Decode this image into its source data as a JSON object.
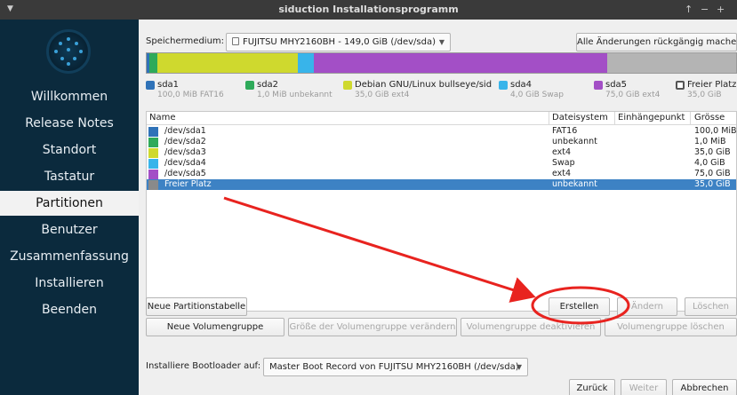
{
  "window": {
    "title": "siduction Installationsprogramm",
    "controls": [
      "↑",
      "−",
      "+"
    ]
  },
  "sidebar": {
    "items": [
      {
        "label": "Willkommen",
        "active": false
      },
      {
        "label": "Release Notes",
        "active": false
      },
      {
        "label": "Standort",
        "active": false
      },
      {
        "label": "Tastatur",
        "active": false
      },
      {
        "label": "Partitionen",
        "active": true
      },
      {
        "label": "Benutzer",
        "active": false
      },
      {
        "label": "Zusammenfassung",
        "active": false
      },
      {
        "label": "Installieren",
        "active": false
      },
      {
        "label": "Beenden",
        "active": false
      }
    ]
  },
  "storage": {
    "label": "Speichermedium:",
    "device": "FUJITSU MHY2160BH - 149,0 GiB (/dev/sda)",
    "revert_button": "Alle Änderungen rückgängig machen"
  },
  "partition_bar": {
    "colors": {
      "sda1": "#2f72b8",
      "sda2": "#2eaa5a",
      "sda3": "#cfd92e",
      "sda4": "#38b4ea",
      "sda5": "#a34fc6",
      "free": "#b4b4b4"
    }
  },
  "legend": [
    {
      "name": "sda1",
      "sub": "100,0 MiB FAT16",
      "color": "#2f72b8"
    },
    {
      "name": "sda2",
      "sub": "1,0 MiB unbekannt",
      "color": "#2eaa5a"
    },
    {
      "name": "Debian GNU/Linux bullseye/sid",
      "sub": "35,0 GiB ext4",
      "color": "#cfd92e"
    },
    {
      "name": "sda4",
      "sub": "4,0 GiB Swap",
      "color": "#38b4ea"
    },
    {
      "name": "sda5",
      "sub": "75,0 GiB ext4",
      "color": "#a34fc6"
    },
    {
      "name": "Freier Platz",
      "sub": "35,0 GiB",
      "color": "#ffffff"
    }
  ],
  "table": {
    "headers": [
      "Name",
      "Dateisystem",
      "Einhängepunkt",
      "Grösse"
    ],
    "rows": [
      {
        "name": "/dev/sda1",
        "fs": "FAT16",
        "mount": "",
        "size": "100,0 MiB",
        "color": "#2f72b8",
        "selected": false
      },
      {
        "name": "/dev/sda2",
        "fs": "unbekannt",
        "mount": "",
        "size": "1,0 MiB",
        "color": "#2eaa5a",
        "selected": false
      },
      {
        "name": "/dev/sda3",
        "fs": "ext4",
        "mount": "",
        "size": "35,0 GiB",
        "color": "#cfd92e",
        "selected": false
      },
      {
        "name": "/dev/sda4",
        "fs": "Swap",
        "mount": "",
        "size": "4,0 GiB",
        "color": "#38b4ea",
        "selected": false
      },
      {
        "name": "/dev/sda5",
        "fs": "ext4",
        "mount": "",
        "size": "75,0 GiB",
        "color": "#a34fc6",
        "selected": false
      },
      {
        "name": "Freier Platz",
        "fs": "unbekannt",
        "mount": "",
        "size": "35,0 GiB",
        "color": "#9a9a9a",
        "selected": true
      }
    ]
  },
  "actions": {
    "new_partition_table": "Neue Partitionstabelle",
    "create": "Erstellen",
    "edit": "Ändern",
    "delete": "Löschen",
    "new_volume_group": "Neue Volumengruppe",
    "resize_volume_group": "Größe der Volumengruppe verändern",
    "deactivate_volume_group": "Volumengruppe deaktivieren",
    "delete_volume_group": "Volumengruppe löschen"
  },
  "bootloader": {
    "label": "Installiere Bootloader auf:",
    "value": "Master Boot Record von FUJITSU MHY2160BH (/dev/sda)"
  },
  "footer": {
    "back": "Zurück",
    "next": "Weiter",
    "cancel": "Abbrechen"
  },
  "annotation": {
    "color": "#e8231f"
  }
}
